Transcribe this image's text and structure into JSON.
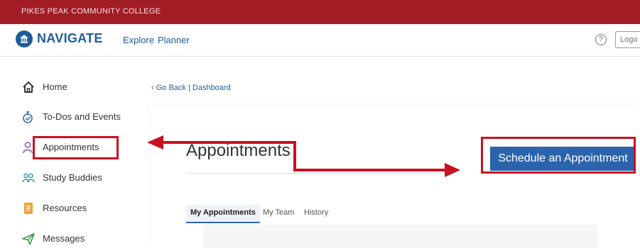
{
  "top_bar": {
    "college_name": "PIKES PEAK COMMUNITY COLLEGE"
  },
  "nav": {
    "logo_text": "NAVIGATE",
    "links": [
      {
        "label": "Explore"
      },
      {
        "label": "Planner"
      }
    ],
    "help_symbol": "?",
    "logout_label": "Logo"
  },
  "sidebar": {
    "items": [
      {
        "label": "Home",
        "icon": "home-icon"
      },
      {
        "label": "To-Dos and Events",
        "icon": "todo-icon"
      },
      {
        "label": "Appointments",
        "icon": "person-icon"
      },
      {
        "label": "Study Buddies",
        "icon": "study-buddies-icon"
      },
      {
        "label": "Resources",
        "icon": "resources-icon"
      },
      {
        "label": "Messages",
        "icon": "send-icon"
      }
    ]
  },
  "content": {
    "back_link": "Go Back | Dashboard",
    "page_title": "Appointments",
    "schedule_button": "Schedule an Appointment",
    "tabs": [
      {
        "label": "My Appointments",
        "active": true
      },
      {
        "label": "My Team",
        "active": false
      },
      {
        "label": "History",
        "active": false
      }
    ]
  },
  "colors": {
    "top_bar": "#a21c26",
    "brand_blue": "#1f5c9a",
    "button_blue": "#2b64ad",
    "annotation_red": "#c81120"
  }
}
